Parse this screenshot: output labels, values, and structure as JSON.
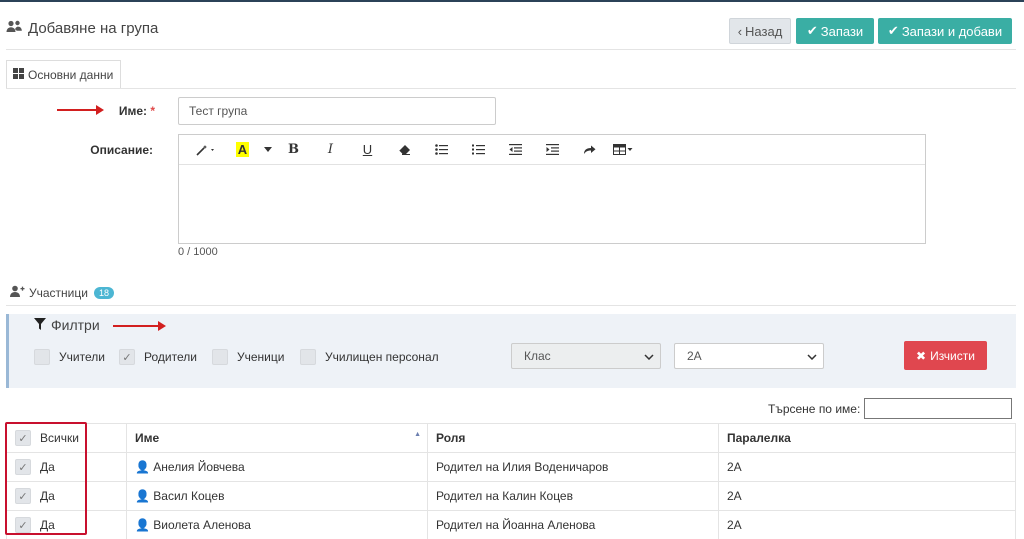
{
  "header": {
    "title": "Добавяне на група",
    "back_label": "Назад",
    "save_label": "Запази",
    "save_add_label": "Запази и добави"
  },
  "tabs": [
    {
      "label": "Основни данни"
    }
  ],
  "form": {
    "name_label": "Име:",
    "required_mark": "*",
    "name_value": "Тест група",
    "description_label": "Описание:",
    "counter": "0 / 1000"
  },
  "participants": {
    "label": "Участници",
    "count": "18"
  },
  "filters": {
    "title": "Филтри",
    "checkboxes": [
      {
        "label": "Учители",
        "checked": false
      },
      {
        "label": "Родители",
        "checked": true
      },
      {
        "label": "Ученици",
        "checked": false
      },
      {
        "label": "Училищен персонал",
        "checked": false
      }
    ],
    "class_select": "Клас",
    "section_select": "2А",
    "clear_label": "Изчисти"
  },
  "search": {
    "label": "Търсене по име:"
  },
  "table": {
    "headers": [
      "Всички",
      "Име",
      "Роля",
      "Паралелка"
    ],
    "rows": [
      {
        "selected": "Да",
        "name": "Анелия Йовчева",
        "role": "Родител на Илия Воденичаров",
        "class": "2А"
      },
      {
        "selected": "Да",
        "name": "Васил Коцев",
        "role": "Родител на Калин Коцев",
        "class": "2А"
      },
      {
        "selected": "Да",
        "name": "Виолета Аленова",
        "role": "Родител на Йоанна Аленова",
        "class": "2А"
      }
    ]
  },
  "colors": {
    "accent": "#3aaea4",
    "danger": "#e0474f",
    "badge": "#4cb6d3",
    "annotation": "#c8102e"
  }
}
